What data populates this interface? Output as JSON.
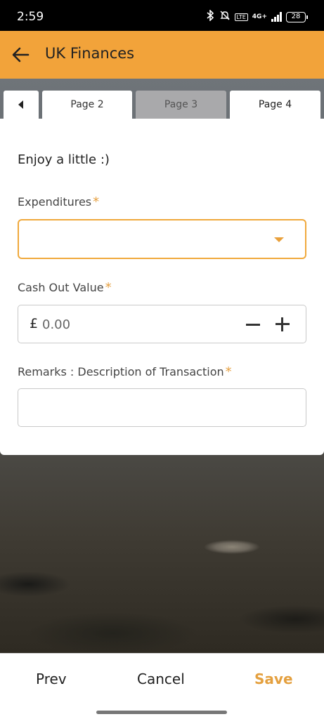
{
  "status_bar": {
    "time": "2:59",
    "network": "4G+",
    "lte": "LTE",
    "battery": "28"
  },
  "app_bar": {
    "title": "UK Finances"
  },
  "tabs": [
    {
      "label": ""
    },
    {
      "label": "Page 2"
    },
    {
      "label": "Page 3"
    },
    {
      "label": "Page 4"
    }
  ],
  "form": {
    "intro": "Enjoy a little :)",
    "expenditures": {
      "label": "Expenditures",
      "required_mark": "*",
      "value": ""
    },
    "cash_out": {
      "label": "Cash Out Value",
      "required_mark": "*",
      "currency": "£",
      "placeholder": "0.00"
    },
    "remarks": {
      "label": "Remarks : Description of Transaction",
      "required_mark": "*",
      "value": ""
    }
  },
  "bottom_bar": {
    "prev": "Prev",
    "cancel": "Cancel",
    "save": "Save"
  },
  "colors": {
    "accent": "#f2a33a",
    "required": "#e6a041",
    "save": "#e4a03f"
  }
}
